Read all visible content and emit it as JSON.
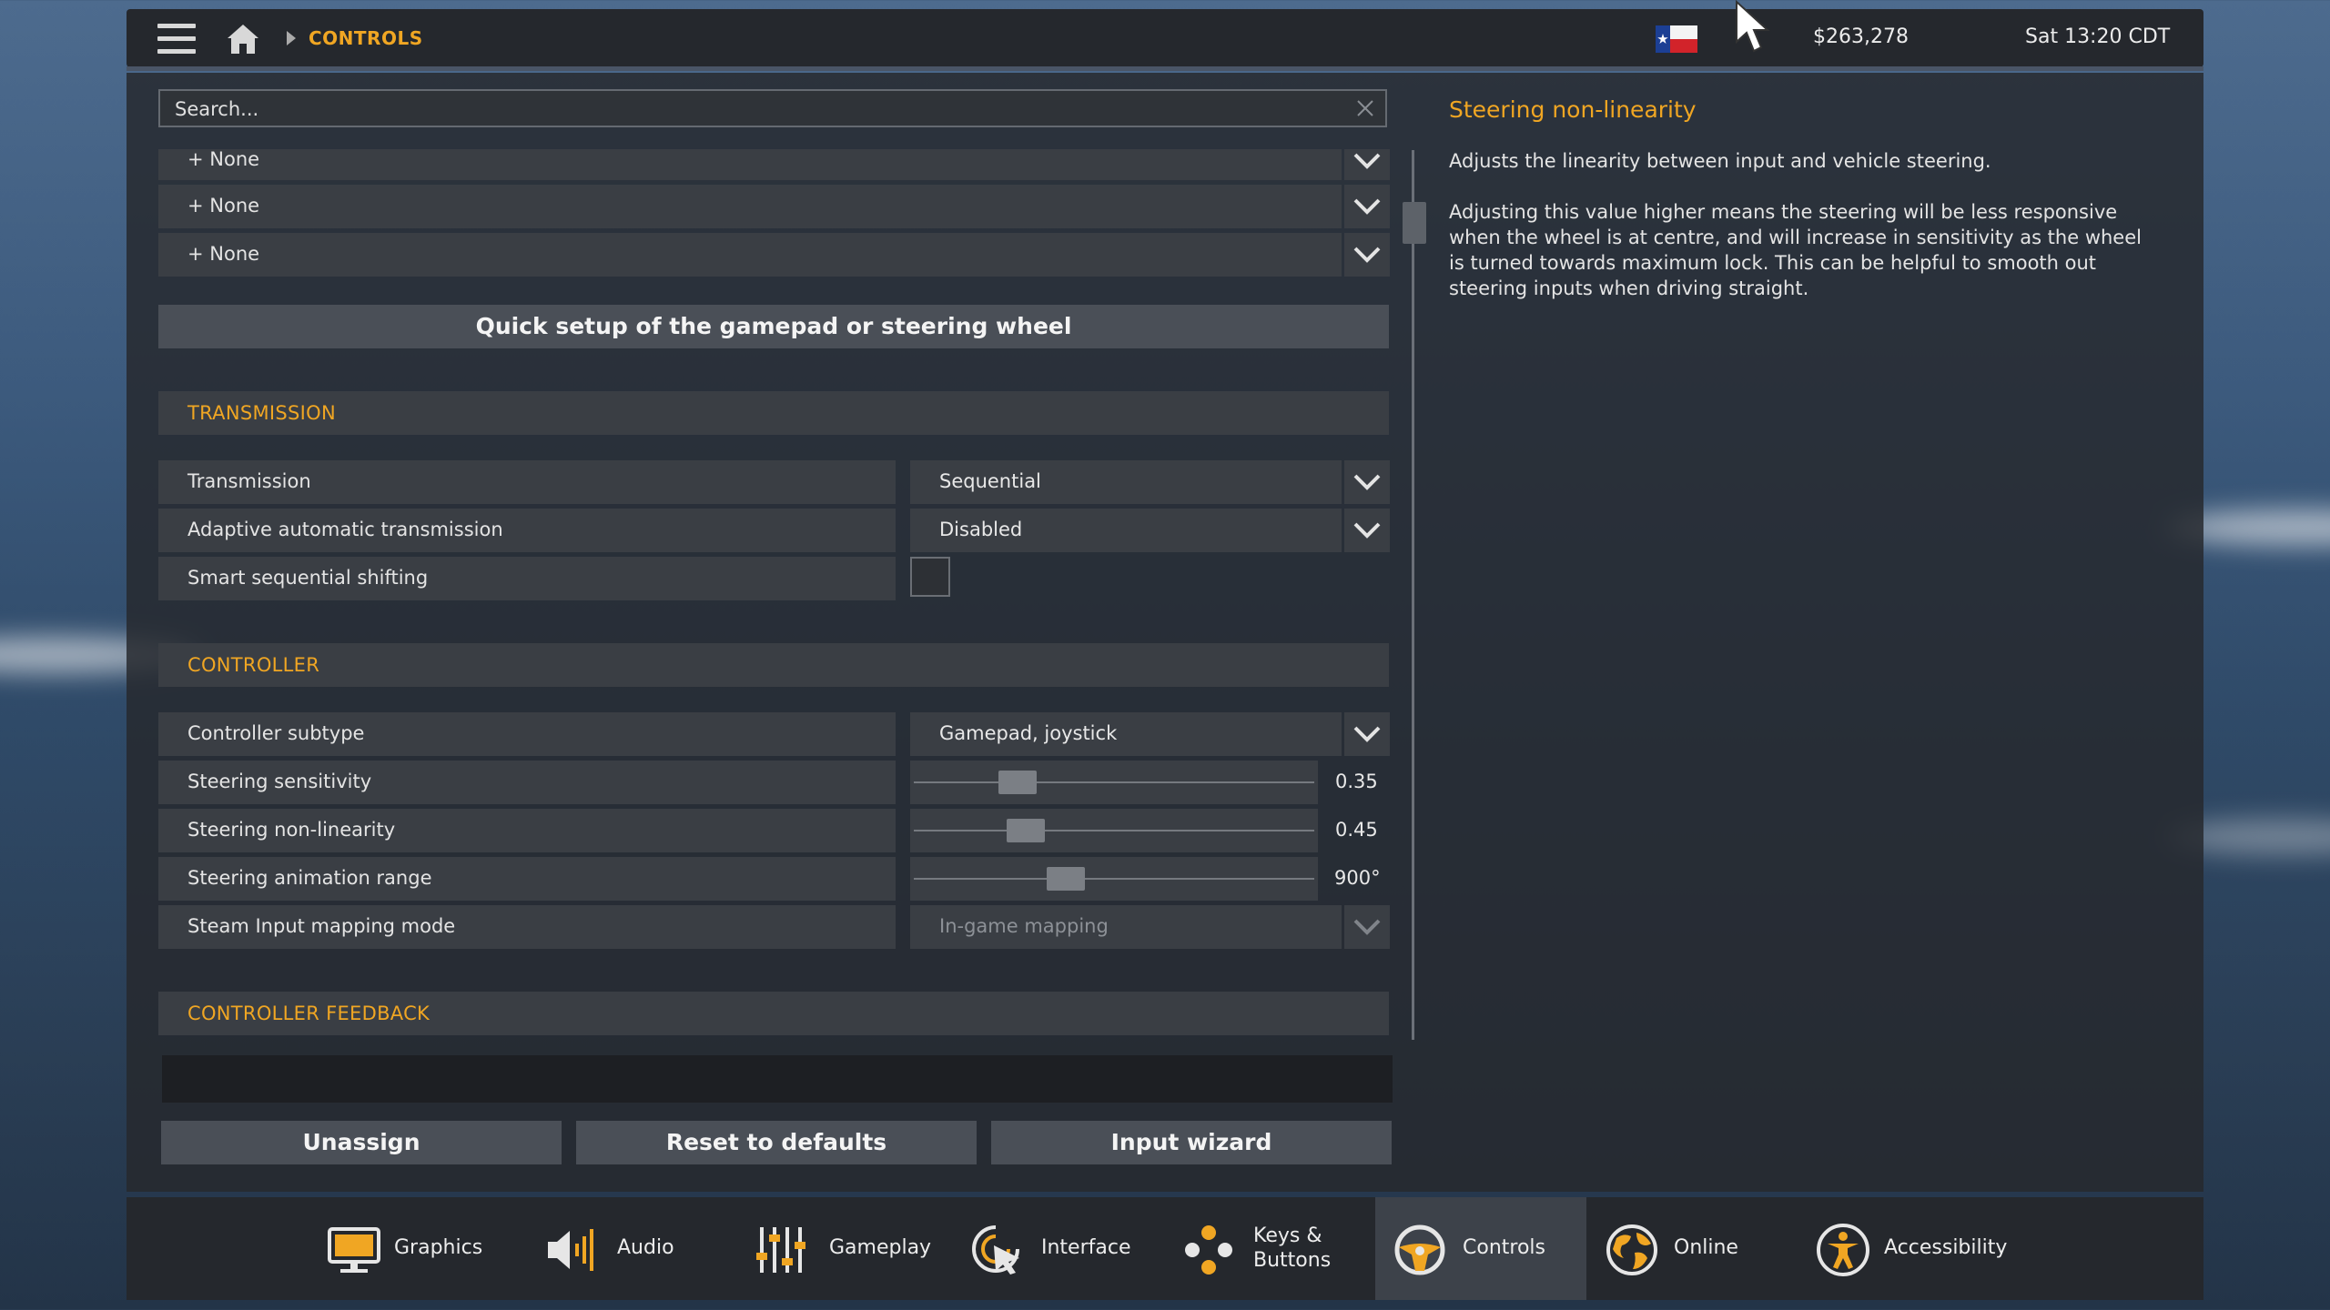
{
  "topbar": {
    "breadcrumb": "CONTROLS",
    "money": "$263,278",
    "time": "Sat 13:20 CDT"
  },
  "search": {
    "placeholder": "Search..."
  },
  "binding_rows": [
    "+ None",
    "+ None",
    "+ None"
  ],
  "quick_setup_label": "Quick setup of the gamepad or steering wheel",
  "sections": {
    "transmission": "TRANSMISSION",
    "controller": "CONTROLLER",
    "controller_feedback": "CONTROLLER FEEDBACK"
  },
  "transmission": {
    "transmission_label": "Transmission",
    "transmission_value": "Sequential",
    "adaptive_label": "Adaptive automatic transmission",
    "adaptive_value": "Disabled",
    "smart_label": "Smart sequential shifting",
    "smart_checked": false
  },
  "controller": {
    "subtype_label": "Controller subtype",
    "subtype_value": "Gamepad, joystick",
    "sensitivity_label": "Steering sensitivity",
    "sensitivity_value": "0.35",
    "sensitivity_level": 0.24,
    "nonlinearity_label": "Steering non-linearity",
    "nonlinearity_value": "0.45",
    "nonlinearity_level": 0.26,
    "animation_label": "Steering animation range",
    "animation_value": "900°",
    "animation_level": 0.37,
    "steam_label": "Steam Input mapping mode",
    "steam_value": "In-game mapping"
  },
  "buttons": {
    "unassign": "Unassign",
    "reset": "Reset to defaults",
    "wizard": "Input wizard"
  },
  "help": {
    "title": "Steering non-linearity",
    "p1": "Adjusts the linearity between input and vehicle steering.",
    "p2": "Adjusting this value higher means the steering will be less responsive when the wheel is at centre, and will increase in sensitivity as the wheel is turned towards maximum lock. This can be helpful to smooth out steering inputs when driving straight."
  },
  "nav": {
    "graphics": "Graphics",
    "audio": "Audio",
    "gameplay": "Gameplay",
    "interface": "Interface",
    "keys_line1": "Keys &",
    "keys_line2": "Buttons",
    "controls": "Controls",
    "online": "Online",
    "accessibility": "Accessibility"
  },
  "colors": {
    "accent": "#f0a623",
    "panel": "#26282d",
    "row": "#3a3e44"
  }
}
